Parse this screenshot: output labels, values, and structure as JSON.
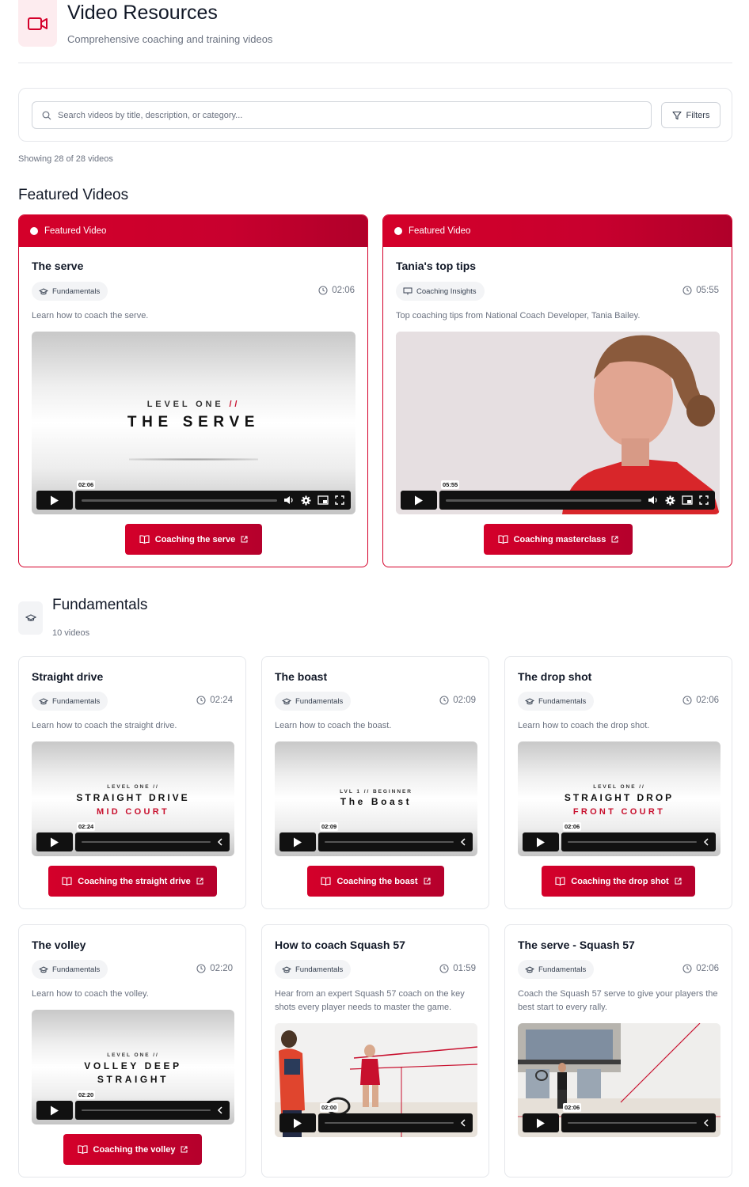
{
  "header": {
    "title": "Video Resources",
    "subtitle": "Comprehensive coaching and training videos",
    "icon": "video-camera-icon",
    "accent": "#d4002a"
  },
  "search": {
    "placeholder": "Search videos by title, description, or category...",
    "value": "",
    "filters_label": "Filters"
  },
  "showing": "Showing 28 of 28 videos",
  "featured": {
    "heading": "Featured Videos",
    "badge": "Featured Video",
    "items": [
      {
        "title": "The serve",
        "tag": "Fundamentals",
        "duration": "02:06",
        "description": "Learn how to coach the serve.",
        "thumb_small": "LEVEL ONE",
        "thumb_small_suffix": "//",
        "thumb_title": "THE SERVE",
        "time": "02:06",
        "cta": "Coaching the serve"
      },
      {
        "title": "Tania's top tips",
        "tag": "Coaching Insights",
        "duration": "05:55",
        "description": "Top coaching tips from National Coach Developer, Tania Bailey.",
        "time": "05:55",
        "cta": "Coaching masterclass"
      }
    ]
  },
  "category": {
    "title": "Fundamentals",
    "count": "10 videos",
    "items": [
      {
        "title": "Straight drive",
        "tag": "Fundamentals",
        "duration": "02:24",
        "description": "Learn how to coach the straight drive.",
        "thumb_small": "LEVEL ONE //",
        "thumb_line1": "STRAIGHT DRIVE",
        "thumb_line2": "MID COURT",
        "time": "02:24",
        "cta": "Coaching the straight drive"
      },
      {
        "title": "The boast",
        "tag": "Fundamentals",
        "duration": "02:09",
        "description": "Learn how to coach the boast.",
        "thumb_small": "LVL 1 // BEGINNER",
        "thumb_line1": "The Boast",
        "time": "02:09",
        "cta": "Coaching the boast"
      },
      {
        "title": "The drop shot",
        "tag": "Fundamentals",
        "duration": "02:06",
        "description": "Learn how to coach the drop shot.",
        "thumb_small": "LEVEL ONE //",
        "thumb_line1": "STRAIGHT DROP",
        "thumb_line2": "FRONT COURT",
        "time": "02:06",
        "cta": "Coaching the drop shot"
      },
      {
        "title": "The volley",
        "tag": "Fundamentals",
        "duration": "02:20",
        "description": "Learn how to coach the volley.",
        "thumb_small": "LEVEL ONE //",
        "thumb_line1": "VOLLEY DEEP",
        "thumb_line2": "STRAIGHT",
        "time": "02:20",
        "cta": "Coaching the volley"
      },
      {
        "title": "How to coach Squash 57",
        "tag": "Fundamentals",
        "duration": "01:59",
        "description": "Hear from an expert Squash 57 coach on the key shots every player needs to master the game.",
        "time": "02:00"
      },
      {
        "title": "The serve - Squash 57",
        "tag": "Fundamentals",
        "duration": "02:06",
        "description": "Coach the Squash 57 serve to give your players the best start to every rally.",
        "time": "02:06"
      }
    ]
  }
}
